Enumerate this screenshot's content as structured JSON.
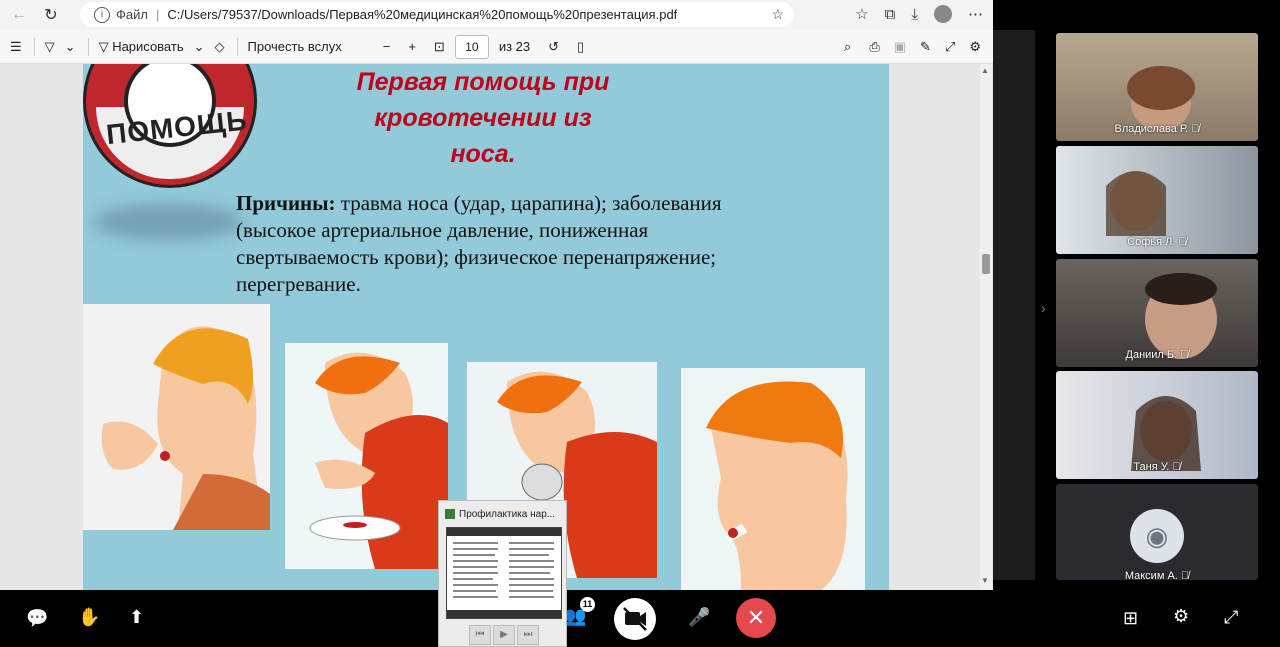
{
  "browser": {
    "file_label": "Файл",
    "url": "C:/Users/79537/Downloads/Первая%20медицинская%20помощь%20презентация.pdf"
  },
  "pdf_toolbar": {
    "draw_label": "Нарисовать",
    "read_aloud_label": "Прочесть вслух",
    "page_current": "10",
    "page_total": "из 23"
  },
  "slide": {
    "logo_word": "ПОМОЩЬ",
    "title_lines": [
      "Первая помощь при",
      "кровотечении из",
      "носа."
    ],
    "causes_bold": "Причины:",
    "causes_text": " травма носа (удар, царапина); заболевания (высокое артериальное давление, пониженная свертываемость крови); физическое перенапряжение; перегревание."
  },
  "participants": [
    {
      "name": "Владислава Р."
    },
    {
      "name": "Софья Л."
    },
    {
      "name": "Даниил Б."
    },
    {
      "name": "Таня У."
    },
    {
      "name": "Максим А."
    }
  ],
  "popup": {
    "title": "Профилактика нар..."
  },
  "meeting": {
    "participant_count": "11"
  }
}
